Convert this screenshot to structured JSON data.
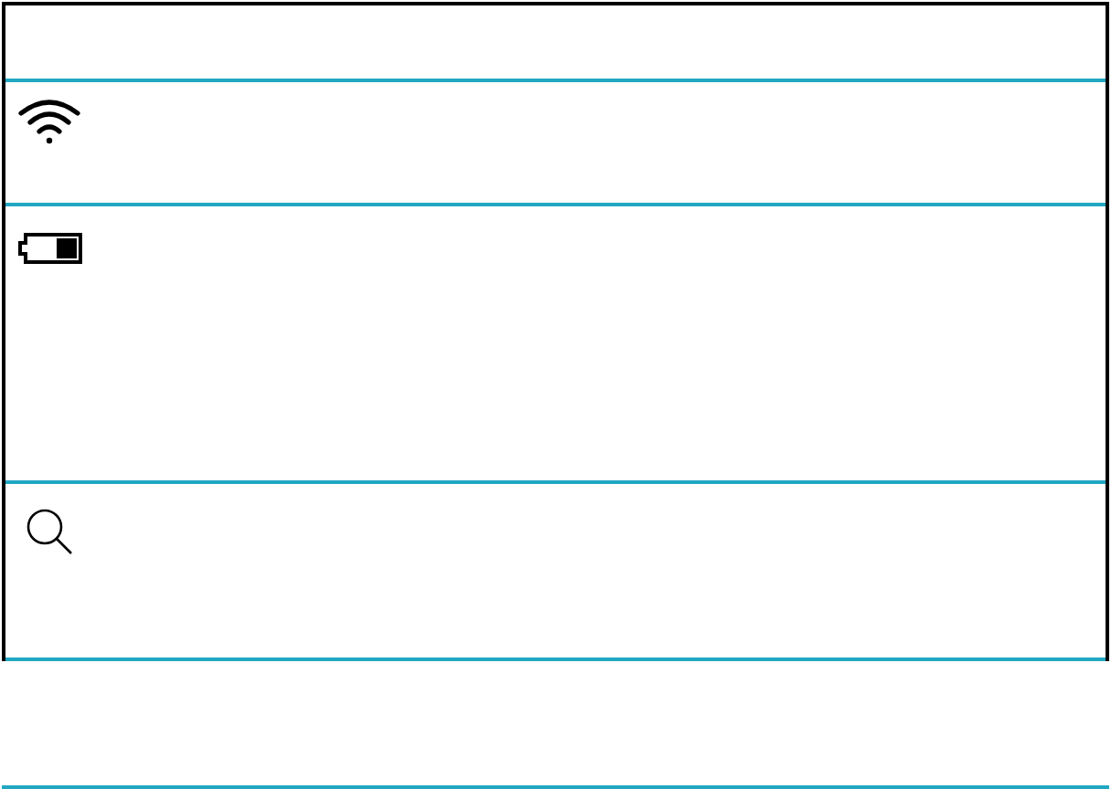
{
  "panel": {
    "rows": [
      {
        "kind": "empty"
      },
      {
        "kind": "wifi"
      },
      {
        "kind": "battery"
      },
      {
        "kind": "search"
      }
    ]
  }
}
